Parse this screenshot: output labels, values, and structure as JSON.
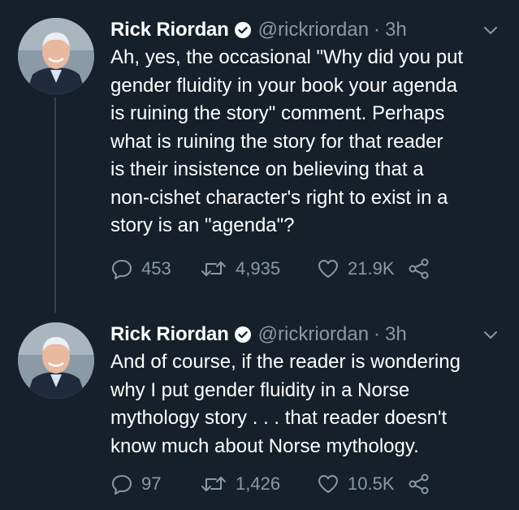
{
  "tweets": [
    {
      "author": "Rick Riordan",
      "handle": "@rickriordan",
      "separator": "·",
      "time": "3h",
      "text": "Ah, yes, the occasional \"Why did you put\ngender fluidity in your book your agenda\nis ruining the story\" comment. Perhaps\nwhat is ruining the story for that reader\nis their insistence on believing that a\nnon-cishet character's right to exist in a\nstory is an \"agenda\"?",
      "replies": "453",
      "retweets": "4,935",
      "likes": "21.9K"
    },
    {
      "author": "Rick Riordan",
      "handle": "@rickriordan",
      "separator": "·",
      "time": "3h",
      "text": "And of course, if the reader is wondering\nwhy I put gender fluidity in a Norse\nmythology story . . . that reader doesn't\nknow much about Norse mythology.",
      "replies": "97",
      "retweets": "1,426",
      "likes": "10.5K"
    }
  ],
  "icons": {
    "verified": "verified-badge-icon",
    "menu": "chevron-down-icon",
    "reply": "reply-icon",
    "retweet": "retweet-icon",
    "like": "heart-icon",
    "share": "share-icon"
  },
  "colors": {
    "background": "#15202b",
    "text": "#ffffff",
    "secondary": "#8899a6",
    "thread_line": "#38444d"
  }
}
